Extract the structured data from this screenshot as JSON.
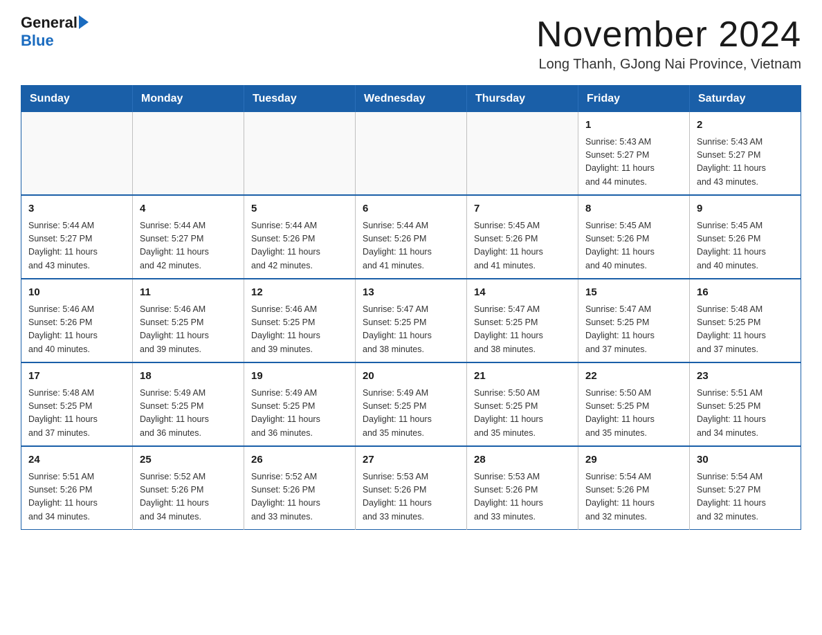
{
  "header": {
    "logo_general": "General",
    "logo_blue": "Blue",
    "title": "November 2024",
    "location": "Long Thanh, GJong Nai Province, Vietnam"
  },
  "days_of_week": [
    "Sunday",
    "Monday",
    "Tuesday",
    "Wednesday",
    "Thursday",
    "Friday",
    "Saturday"
  ],
  "weeks": [
    [
      {
        "day": "",
        "info": ""
      },
      {
        "day": "",
        "info": ""
      },
      {
        "day": "",
        "info": ""
      },
      {
        "day": "",
        "info": ""
      },
      {
        "day": "",
        "info": ""
      },
      {
        "day": "1",
        "info": "Sunrise: 5:43 AM\nSunset: 5:27 PM\nDaylight: 11 hours\nand 44 minutes."
      },
      {
        "day": "2",
        "info": "Sunrise: 5:43 AM\nSunset: 5:27 PM\nDaylight: 11 hours\nand 43 minutes."
      }
    ],
    [
      {
        "day": "3",
        "info": "Sunrise: 5:44 AM\nSunset: 5:27 PM\nDaylight: 11 hours\nand 43 minutes."
      },
      {
        "day": "4",
        "info": "Sunrise: 5:44 AM\nSunset: 5:27 PM\nDaylight: 11 hours\nand 42 minutes."
      },
      {
        "day": "5",
        "info": "Sunrise: 5:44 AM\nSunset: 5:26 PM\nDaylight: 11 hours\nand 42 minutes."
      },
      {
        "day": "6",
        "info": "Sunrise: 5:44 AM\nSunset: 5:26 PM\nDaylight: 11 hours\nand 41 minutes."
      },
      {
        "day": "7",
        "info": "Sunrise: 5:45 AM\nSunset: 5:26 PM\nDaylight: 11 hours\nand 41 minutes."
      },
      {
        "day": "8",
        "info": "Sunrise: 5:45 AM\nSunset: 5:26 PM\nDaylight: 11 hours\nand 40 minutes."
      },
      {
        "day": "9",
        "info": "Sunrise: 5:45 AM\nSunset: 5:26 PM\nDaylight: 11 hours\nand 40 minutes."
      }
    ],
    [
      {
        "day": "10",
        "info": "Sunrise: 5:46 AM\nSunset: 5:26 PM\nDaylight: 11 hours\nand 40 minutes."
      },
      {
        "day": "11",
        "info": "Sunrise: 5:46 AM\nSunset: 5:25 PM\nDaylight: 11 hours\nand 39 minutes."
      },
      {
        "day": "12",
        "info": "Sunrise: 5:46 AM\nSunset: 5:25 PM\nDaylight: 11 hours\nand 39 minutes."
      },
      {
        "day": "13",
        "info": "Sunrise: 5:47 AM\nSunset: 5:25 PM\nDaylight: 11 hours\nand 38 minutes."
      },
      {
        "day": "14",
        "info": "Sunrise: 5:47 AM\nSunset: 5:25 PM\nDaylight: 11 hours\nand 38 minutes."
      },
      {
        "day": "15",
        "info": "Sunrise: 5:47 AM\nSunset: 5:25 PM\nDaylight: 11 hours\nand 37 minutes."
      },
      {
        "day": "16",
        "info": "Sunrise: 5:48 AM\nSunset: 5:25 PM\nDaylight: 11 hours\nand 37 minutes."
      }
    ],
    [
      {
        "day": "17",
        "info": "Sunrise: 5:48 AM\nSunset: 5:25 PM\nDaylight: 11 hours\nand 37 minutes."
      },
      {
        "day": "18",
        "info": "Sunrise: 5:49 AM\nSunset: 5:25 PM\nDaylight: 11 hours\nand 36 minutes."
      },
      {
        "day": "19",
        "info": "Sunrise: 5:49 AM\nSunset: 5:25 PM\nDaylight: 11 hours\nand 36 minutes."
      },
      {
        "day": "20",
        "info": "Sunrise: 5:49 AM\nSunset: 5:25 PM\nDaylight: 11 hours\nand 35 minutes."
      },
      {
        "day": "21",
        "info": "Sunrise: 5:50 AM\nSunset: 5:25 PM\nDaylight: 11 hours\nand 35 minutes."
      },
      {
        "day": "22",
        "info": "Sunrise: 5:50 AM\nSunset: 5:25 PM\nDaylight: 11 hours\nand 35 minutes."
      },
      {
        "day": "23",
        "info": "Sunrise: 5:51 AM\nSunset: 5:25 PM\nDaylight: 11 hours\nand 34 minutes."
      }
    ],
    [
      {
        "day": "24",
        "info": "Sunrise: 5:51 AM\nSunset: 5:26 PM\nDaylight: 11 hours\nand 34 minutes."
      },
      {
        "day": "25",
        "info": "Sunrise: 5:52 AM\nSunset: 5:26 PM\nDaylight: 11 hours\nand 34 minutes."
      },
      {
        "day": "26",
        "info": "Sunrise: 5:52 AM\nSunset: 5:26 PM\nDaylight: 11 hours\nand 33 minutes."
      },
      {
        "day": "27",
        "info": "Sunrise: 5:53 AM\nSunset: 5:26 PM\nDaylight: 11 hours\nand 33 minutes."
      },
      {
        "day": "28",
        "info": "Sunrise: 5:53 AM\nSunset: 5:26 PM\nDaylight: 11 hours\nand 33 minutes."
      },
      {
        "day": "29",
        "info": "Sunrise: 5:54 AM\nSunset: 5:26 PM\nDaylight: 11 hours\nand 32 minutes."
      },
      {
        "day": "30",
        "info": "Sunrise: 5:54 AM\nSunset: 5:27 PM\nDaylight: 11 hours\nand 32 minutes."
      }
    ]
  ]
}
